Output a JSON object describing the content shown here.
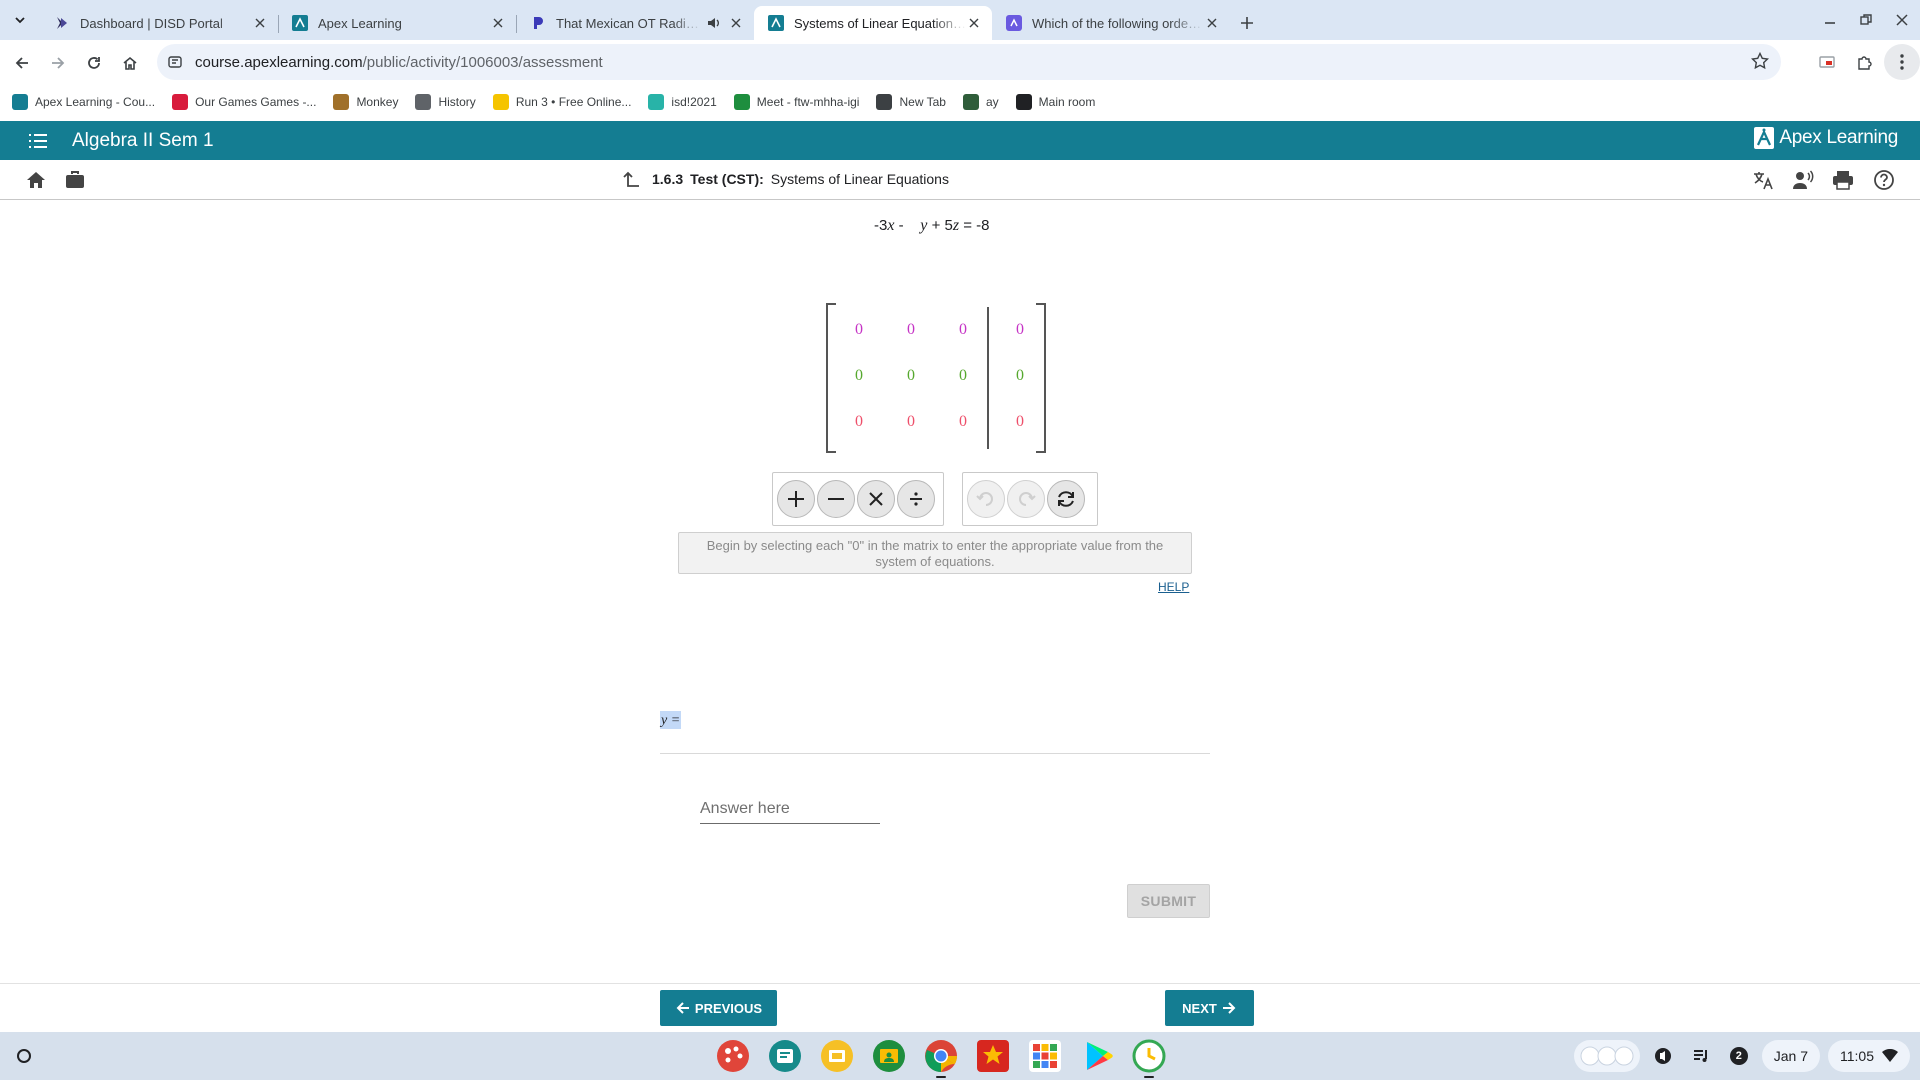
{
  "browser": {
    "tabs": [
      {
        "title": "Dashboard | DISD Portal",
        "icon": "disd-icon",
        "active": false
      },
      {
        "title": "Apex Learning",
        "icon": "apex-icon",
        "active": false
      },
      {
        "title": "That Mexican OT Radio - N",
        "icon": "pandora-icon",
        "active": false,
        "audio": true
      },
      {
        "title": "Systems of Linear Equations - A",
        "icon": "apex-icon",
        "active": true
      },
      {
        "title": "Which of the following ordered",
        "icon": "app-icon",
        "active": false
      }
    ],
    "url_host": "course.apexlearning.com",
    "url_path": "/public/activity/1006003/assessment",
    "bookmarks": [
      {
        "label": "Apex Learning - Cou...",
        "color": "#147d92"
      },
      {
        "label": "Our Games Games -...",
        "color": "#d81b3c"
      },
      {
        "label": "Monkey",
        "color": "#a0702a"
      },
      {
        "label": "History",
        "color": "#5f6368"
      },
      {
        "label": "Run 3 • Free Online...",
        "color": "#f5c400"
      },
      {
        "label": "isd!2021",
        "color": "#28b3a8"
      },
      {
        "label": "Meet - ftw-mhha-igi",
        "color": "#1e8e3e"
      },
      {
        "label": "New Tab",
        "color": "#3c4043"
      },
      {
        "label": "ay",
        "color": "#2f5d3a"
      },
      {
        "label": "Main room",
        "color": "#202124"
      }
    ]
  },
  "header": {
    "course_title": "Algebra II Sem 1",
    "brand": "Apex Learning",
    "brand_color": "#147d92"
  },
  "activity": {
    "number": "1.6.3",
    "type": "Test (CST):",
    "title": "Systems of Linear Equations"
  },
  "question": {
    "equation_parts": [
      "-3",
      "x",
      " -    ",
      "y",
      " + 5",
      "z",
      " = -8"
    ],
    "matrix": [
      [
        "0",
        "0",
        "0",
        "0"
      ],
      [
        "0",
        "0",
        "0",
        "0"
      ],
      [
        "0",
        "0",
        "0",
        "0"
      ]
    ],
    "row_colors": [
      "#c533c5",
      "#56a82e",
      "#ee4f6a"
    ],
    "hint": "Begin by selecting each \"0\" in the matrix to enter the appropriate value from the system of equations.",
    "help_label": "HELP",
    "variable_label": "y =",
    "answer_placeholder": "Answer here",
    "submit_label": "SUBMIT"
  },
  "navigation": {
    "previous_label": "PREVIOUS",
    "next_label": "NEXT"
  },
  "shelf": {
    "date": "Jan 7",
    "time": "11:05",
    "notifications": "2"
  }
}
